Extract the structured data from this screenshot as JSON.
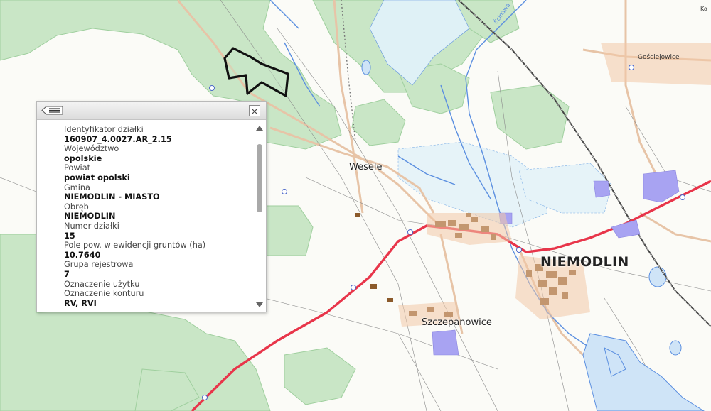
{
  "map": {
    "labels": {
      "town": "NIEMODLIN",
      "wesele": "Wesele",
      "szczepanowice": "Szczepanowice",
      "gosciejowice": "Gościejowice",
      "stream": "Ścinawa",
      "corner": "Ko"
    }
  },
  "popup": {
    "fields": [
      {
        "label": "Identyfikator działki",
        "value": "160907_4.0027.AR_2.15"
      },
      {
        "label": "Województwo",
        "value": "opolskie"
      },
      {
        "label": "Powiat",
        "value": "powiat opolski"
      },
      {
        "label": "Gmina",
        "value": "NIEMODLIN - MIASTO"
      },
      {
        "label": "Obręb",
        "value": "NIEMODLIN"
      },
      {
        "label": "Numer działki",
        "value": "15"
      },
      {
        "label": "Pole pow. w ewidencji gruntów (ha)",
        "value": "10.7640"
      },
      {
        "label": "Grupa rejestrowa",
        "value": "7"
      },
      {
        "label": "Oznaczenie użytku",
        "value": ""
      },
      {
        "label": "Oznaczenie konturu",
        "value": "RV, RVI"
      }
    ]
  },
  "colors": {
    "forest": "#c9e6c6",
    "forest_edge": "#9fcf9e",
    "road_main": "#e8354a",
    "road_minor": "#e7c4a7",
    "water": "#5b8fe0",
    "buildings": "#8b5a2b",
    "industrial": "#a8a3f2",
    "parcel_outline": "#111111"
  }
}
